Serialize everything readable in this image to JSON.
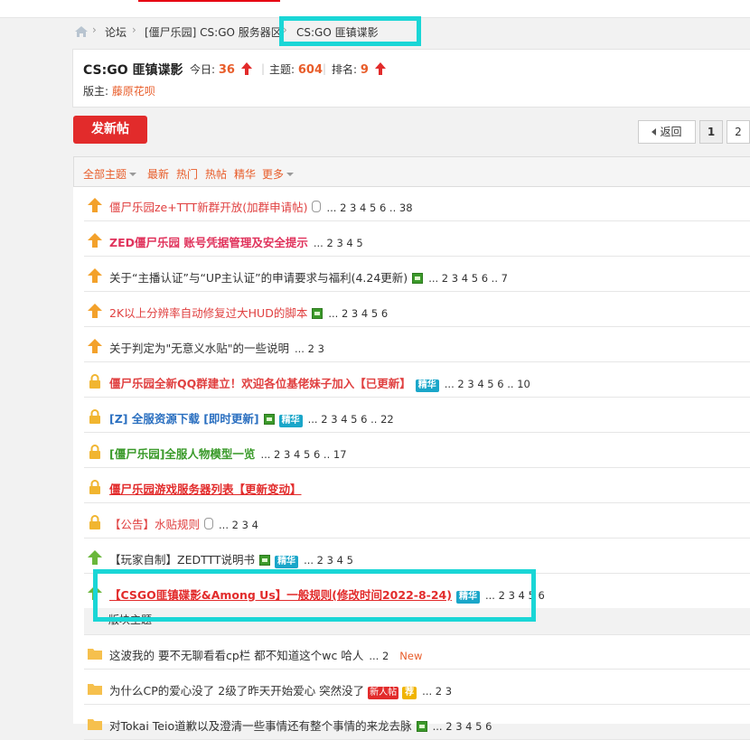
{
  "breadcrumb": {
    "items": [
      "论坛",
      "[僵尸乐园] CS:GO 服务器区",
      "CS:GO 匪镇谍影"
    ],
    "separator": "›",
    "first_separator": "›",
    "bracket_sep": "["
  },
  "forum": {
    "name": "CS:GO 匪镇谍影",
    "today_label": "今日:",
    "today_value": "36",
    "topics_label": "主题:",
    "topics_value": "604",
    "rank_label": "排名:",
    "rank_value": "9",
    "moderator_label": "版主:",
    "moderator_name": "藤原花呗"
  },
  "actions": {
    "new_post": "发新帖"
  },
  "pager": {
    "back": "返回",
    "pages": [
      "1",
      "2"
    ]
  },
  "filters": {
    "all": "全部主题",
    "items": [
      "最新",
      "热门",
      "热帖",
      "精华",
      "更多"
    ]
  },
  "threads": [
    {
      "icon": "pin-up-icon",
      "title": "僵尸乐园ze+TTT新群开放(加群申请帖)",
      "style": "c-red",
      "clip": true,
      "img": false,
      "jing": false,
      "pages": "... 2 3 4 5 6 .. 38"
    },
    {
      "icon": "pin-up-icon",
      "title": "ZED僵尸乐园 账号凭据管理及安全提示",
      "style": "c-pink",
      "clip": false,
      "img": false,
      "jing": false,
      "pages": "... 2 3 4 5"
    },
    {
      "icon": "pin-up-icon",
      "title": "关于“主播认证”与“UP主认证”的申请要求与福利(4.24更新)",
      "style": "c-dark",
      "clip": false,
      "img": true,
      "jing": false,
      "pages": "... 2 3 4 5 6 .. 7"
    },
    {
      "icon": "pin-up-icon",
      "title": "2K以上分辨率自动修复过大HUD的脚本",
      "style": "c-red",
      "clip": false,
      "img": true,
      "jing": false,
      "pages": "... 2 3 4 5 6"
    },
    {
      "icon": "pin-up-icon",
      "title": "关于判定为\"无意义水贴\"的一些说明",
      "style": "c-dark",
      "clip": false,
      "img": false,
      "jing": false,
      "pages": "... 2 3"
    },
    {
      "icon": "lock-icon",
      "title": "僵尸乐园全新QQ群建立！欢迎各位基佬妹子加入【已更新】",
      "style": "c-redb-nu",
      "clip": false,
      "img": false,
      "jing": true,
      "pages": "... 2 3 4 5 6 .. 10"
    },
    {
      "icon": "lock-icon",
      "title": "[Z] 全服资源下载 [即时更新]",
      "style": "c-blue",
      "clip": false,
      "img": true,
      "jing": true,
      "pages": "... 2 3 4 5 6 .. 22"
    },
    {
      "icon": "lock-icon",
      "title": "[僵尸乐园]全服人物模型一览",
      "style": "c-green",
      "clip": false,
      "img": false,
      "jing": false,
      "pages": "... 2 3 4 5 6 .. 17"
    },
    {
      "icon": "lock-icon",
      "title": "僵尸乐园游戏服务器列表【更新变动】",
      "style": "c-redb",
      "clip": false,
      "img": false,
      "jing": false,
      "pages": ""
    },
    {
      "icon": "lock-icon",
      "title": "【公告】水贴规则",
      "style": "c-red",
      "clip": true,
      "img": false,
      "jing": false,
      "pages": "... 2 3 4"
    },
    {
      "icon": "pin-green-icon",
      "title": "【玩家自制】ZEDTTT说明书",
      "style": "c-dark",
      "clip": false,
      "img": true,
      "jing": true,
      "pages": "... 2 3 4 5"
    },
    {
      "icon": "pin-green-icon",
      "title": "【CSGO匪镇碟影&Among Us】一般规则(修改时间2022-8-24)",
      "style": "c-redb",
      "clip": false,
      "img": false,
      "jing": true,
      "pages": "... 2 3 4 5 6"
    }
  ],
  "section_label": "版块主题",
  "normal_threads": [
    {
      "title": "这波我的 要不无聊看看cp栏 都不知道这个wc 哈人",
      "pages": "... 2",
      "new": "New",
      "newtag": false,
      "jian": false,
      "img": false
    },
    {
      "title": "为什么CP的爱心没了 2级了昨天开始爱心 突然没了",
      "pages": "... 2 3",
      "new": "",
      "newtag": true,
      "jian": true,
      "img": false
    },
    {
      "title": "对Tokai Teio道歉以及澄清一些事情还有整个事情的来龙去脉",
      "pages": "... 2 3 4 5 6",
      "new": "",
      "newtag": false,
      "jian": false,
      "img": true
    }
  ],
  "labels": {
    "jing": "精华",
    "newpost": "新人帖",
    "jian": "荐"
  },
  "colors": {
    "accent": "#e22b2b",
    "highlight": "#1ad6d6",
    "orange": "#e85d2a"
  }
}
